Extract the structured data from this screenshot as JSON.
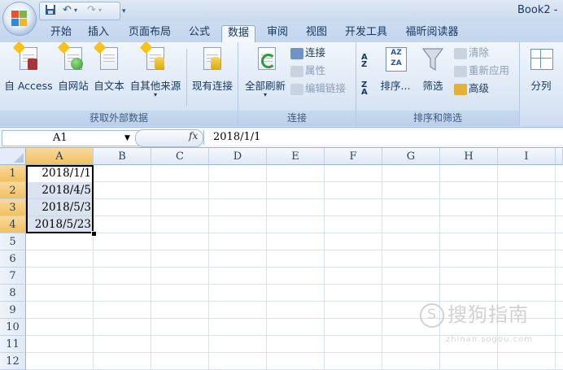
{
  "window": {
    "title": "Book2 - "
  },
  "tabs": [
    {
      "label": "开始"
    },
    {
      "label": "插入"
    },
    {
      "label": "页面布局"
    },
    {
      "label": "公式"
    },
    {
      "label": "数据"
    },
    {
      "label": "审阅"
    },
    {
      "label": "视图"
    },
    {
      "label": "开发工具"
    },
    {
      "label": "福昕阅读器"
    }
  ],
  "ribbon": {
    "external": {
      "label": "获取外部数据",
      "access": "自 Access",
      "web": "自网站",
      "text": "自文本",
      "other": "自其他来源",
      "existing": "现有连接"
    },
    "connections": {
      "label": "连接",
      "refresh_all": "全部刷新",
      "connections": "连接",
      "properties": "属性",
      "edit_links": "编辑链接"
    },
    "sort_filter": {
      "label": "排序和筛选",
      "sort": "排序...",
      "filter": "筛选",
      "clear": "清除",
      "reapply": "重新应用",
      "advanced": "高级"
    },
    "data_tools": {
      "split": "分列"
    }
  },
  "formula_bar": {
    "name_box": "A1",
    "fx": "fx",
    "formula": "2018/1/1"
  },
  "sheet": {
    "columns": [
      "A",
      "B",
      "C",
      "D",
      "E",
      "F",
      "G",
      "H",
      "I"
    ],
    "rows": [
      "1",
      "2",
      "3",
      "4",
      "5",
      "6",
      "7",
      "8",
      "9",
      "10",
      "11",
      "12"
    ],
    "column_a_values": [
      "2018/1/1",
      "2018/4/5",
      "2018/5/3",
      "2018/5/23"
    ]
  },
  "watermark": {
    "text": "搜狗指南",
    "sub": "zhinan.sogou.com"
  },
  "colors": {
    "accent": "#2b579a",
    "selection": "#f1c15f"
  }
}
